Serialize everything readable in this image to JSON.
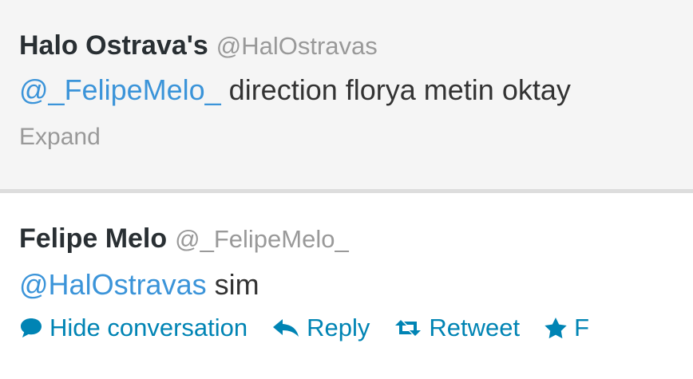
{
  "tweets": [
    {
      "author_name": "Halo Ostrava's",
      "author_handle": "@HalOstravas",
      "mention": "@_FelipeMelo_",
      "text": " direction florya metin oktay",
      "expand_label": "Expand"
    },
    {
      "author_name": "Felipe Melo",
      "author_handle": "@_FelipeMelo_",
      "mention": "@HalOstravas",
      "text": " sim"
    }
  ],
  "actions": {
    "hide_conversation_label": "Hide conversation",
    "reply_label": "Reply",
    "retweet_label": "Retweet",
    "favorite_label": "F"
  },
  "colors": {
    "link": "#0084b4",
    "mention": "#3b94d9",
    "muted": "#999999",
    "name": "#292f33"
  },
  "icons": [
    "speech-bubble-icon",
    "reply-arrow-icon",
    "retweet-icon",
    "star-icon"
  ]
}
